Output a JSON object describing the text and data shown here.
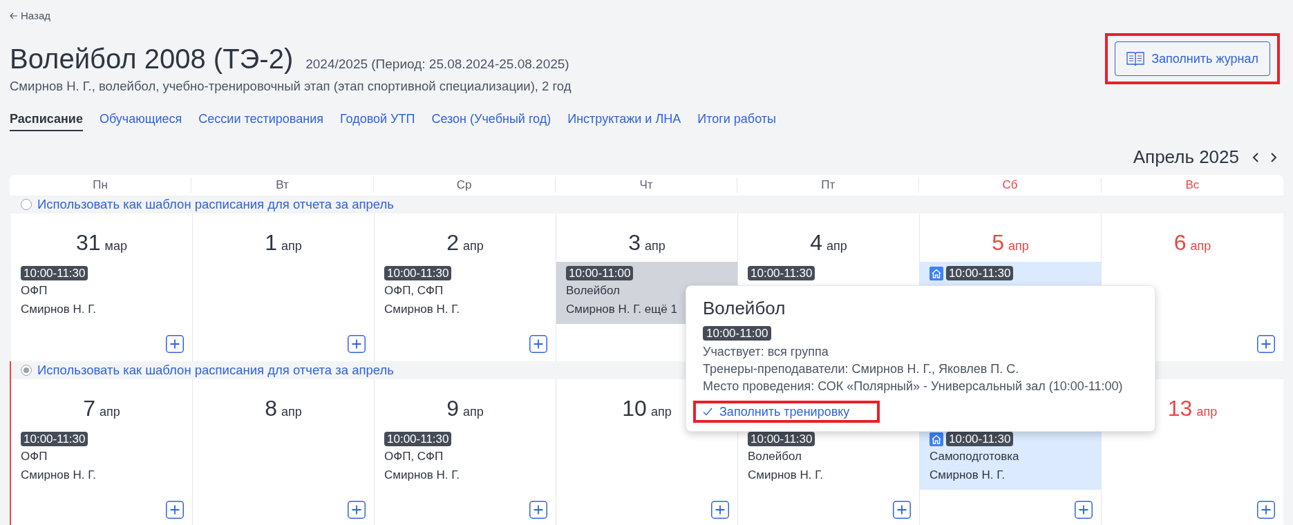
{
  "back_link": "Назад",
  "title": "Волейбол 2008 (ТЭ-2)",
  "period": "2024/2025 (Период: 25.08.2024-25.08.2025)",
  "subtitle": "Смирнов Н. Г., волейбол, учебно-тренировочный этап (этап спортивной специализации), 2 год",
  "journal_button": {
    "label": "Заполнить журнал",
    "highlighted": true
  },
  "tabs": [
    {
      "label": "Расписание",
      "selected": true
    },
    {
      "label": "Обучающиеся",
      "selected": false
    },
    {
      "label": "Сессии тестирования",
      "selected": false
    },
    {
      "label": "Годовой УТП",
      "selected": false
    },
    {
      "label": "Сезон (Учебный год)",
      "selected": false
    },
    {
      "label": "Инструктажи и ЛНА",
      "selected": false
    },
    {
      "label": "Итоги работы",
      "selected": false
    }
  ],
  "month": "Апрель 2025",
  "weekdays": [
    {
      "label": "Пн",
      "weekend": false
    },
    {
      "label": "Вт",
      "weekend": false
    },
    {
      "label": "Ср",
      "weekend": false
    },
    {
      "label": "Чт",
      "weekend": false
    },
    {
      "label": "Пт",
      "weekend": false
    },
    {
      "label": "Сб",
      "weekend": true
    },
    {
      "label": "Вс",
      "weekend": true
    }
  ],
  "weeks": [
    {
      "template": {
        "label": "Использовать как шаблон расписания для отчета за апрель",
        "selected": false
      },
      "current": false,
      "days": [
        {
          "day": "31",
          "month": "мар",
          "weekend": false,
          "add_button": true,
          "events": [
            {
              "time": "10:00-11:30",
              "title": "ОФП",
              "coach": "Смирнов Н. Г.",
              "home": false,
              "selected": false
            }
          ]
        },
        {
          "day": "1",
          "month": "апр",
          "weekend": false,
          "add_button": true
        },
        {
          "day": "2",
          "month": "апр",
          "weekend": false,
          "add_button": true,
          "events": [
            {
              "time": "10:00-11:30",
              "title": "ОФП, СФП",
              "coach": "Смирнов Н. Г.",
              "home": false,
              "selected": false
            }
          ]
        },
        {
          "day": "3",
          "month": "апр",
          "weekend": false,
          "events": [
            {
              "time": "10:00-11:00",
              "title": "Волейбол",
              "coach": "Смирнов Н. Г. ещё 1",
              "home": false,
              "selected": true
            }
          ]
        },
        {
          "day": "4",
          "month": "апр",
          "weekend": false,
          "events": [
            {
              "time": "10:00-11:30",
              "home": false,
              "selected": false
            }
          ]
        },
        {
          "day": "5",
          "month": "апр",
          "weekend": true,
          "events": [
            {
              "time": "10:00-11:30",
              "home": true,
              "selected": false
            }
          ]
        },
        {
          "day": "6",
          "month": "апр",
          "weekend": true,
          "add_button": true
        }
      ]
    },
    {
      "template": {
        "label": "Использовать как шаблон расписания для отчета за апрель",
        "selected": true
      },
      "current": true,
      "days": [
        {
          "day": "7",
          "month": "апр",
          "weekend": false,
          "add_button": true,
          "events": [
            {
              "time": "10:00-11:30",
              "title": "ОФП",
              "coach": "Смирнов Н. Г.",
              "home": false,
              "selected": false
            }
          ]
        },
        {
          "day": "8",
          "month": "апр",
          "weekend": false,
          "add_button": true
        },
        {
          "day": "9",
          "month": "апр",
          "weekend": false,
          "add_button": true,
          "events": [
            {
              "time": "10:00-11:30",
              "title": "ОФП, СФП",
              "coach": "Смирнов Н. Г.",
              "home": false,
              "selected": false
            }
          ]
        },
        {
          "day": "10",
          "month": "апр",
          "weekend": false,
          "add_button": true
        },
        {
          "add_button": true,
          "events": [
            {
              "time": "10:00-11:30",
              "title": "Волейбол",
              "coach": "Смирнов Н. Г.",
              "home": false,
              "selected": false
            }
          ]
        },
        {
          "add_button": true,
          "events": [
            {
              "time": "10:00-11:30",
              "title": "Самоподготовка",
              "coach": "Смирнов Н. Г.",
              "home": true,
              "selected": false
            }
          ]
        },
        {
          "day": "13",
          "month": "апр",
          "weekend": true,
          "add_button": true
        }
      ]
    }
  ],
  "popup": {
    "title": "Волейбол",
    "time": "10:00-11:00",
    "lines": [
      "Участвует: вся группа",
      "Тренеры-преподаватели: Смирнов Н. Г., Яковлев П. С.",
      "Место проведения: СОК «Полярный» - Универсальный зал (10:00-11:00)"
    ],
    "action": {
      "label": "Заполнить тренировку",
      "highlighted": true
    }
  }
}
